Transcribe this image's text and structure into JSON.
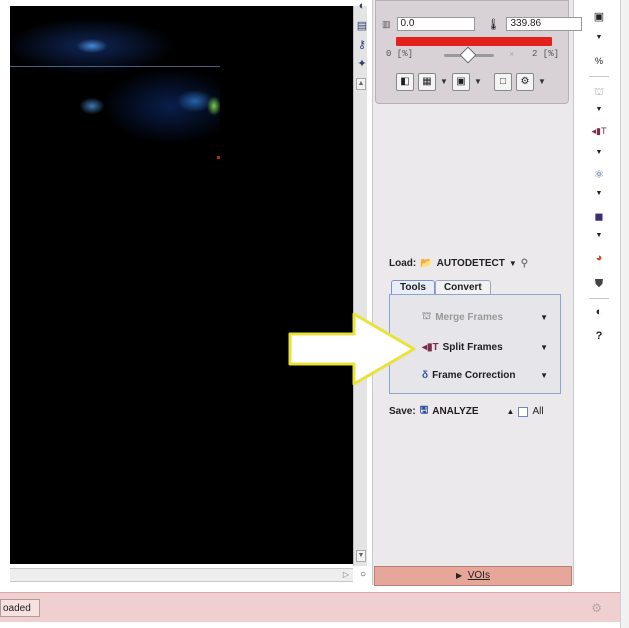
{
  "top_panel": {
    "label_value": "0.0",
    "max_value": "339.86",
    "slider_left": "0 [%]",
    "slider_right": "2 [%]",
    "slider_close": "×"
  },
  "load": {
    "label": "Load:",
    "value": "AUTODETECT"
  },
  "tabs": [
    {
      "label": "Tools",
      "active": true
    },
    {
      "label": "Convert",
      "active": false
    }
  ],
  "tools": {
    "merge_frames": "Merge Frames",
    "split_frames": "Split Frames",
    "frame_correction": "Frame Correction"
  },
  "save": {
    "label": "Save:",
    "value": "ANALYZE",
    "all_label": "All"
  },
  "vois_button": {
    "label": "VOIs"
  },
  "status": {
    "message": "oaded"
  },
  "colors": {
    "accent_red": "#e3201b",
    "vois_bg": "#e7a69a",
    "status_bg": "#efcfcf",
    "arrow_fill": "#ffffff",
    "arrow_stroke": "#e8e23a"
  },
  "icons": {
    "right_toolbar": [
      "terminal-icon",
      "chevron-down-icon",
      "scale-icon",
      "bookmark-icon",
      "chevron-down-icon",
      "split-frames-icon",
      "chevron-down-icon",
      "molecule-icon",
      "chevron-down-icon",
      "square-icon",
      "chevron-down-icon",
      "pie-icon",
      "shield-icon",
      "contrast-icon",
      "help-icon"
    ]
  }
}
